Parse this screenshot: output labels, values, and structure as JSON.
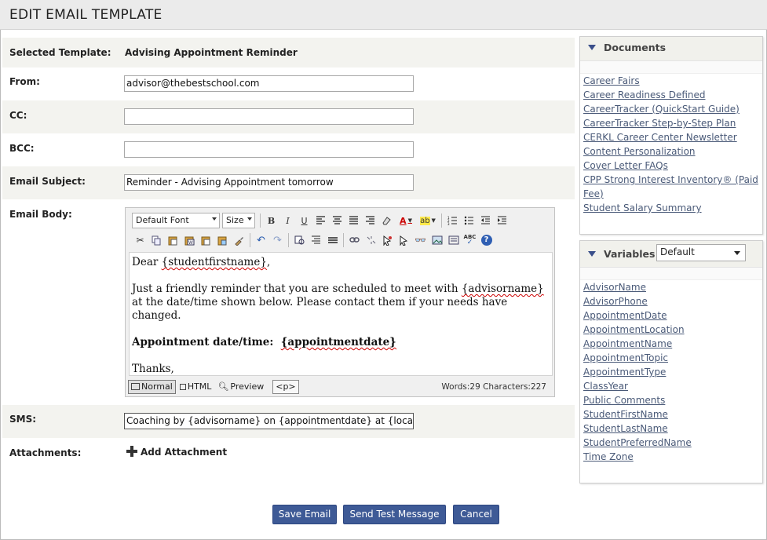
{
  "page_title": "EDIT EMAIL TEMPLATE",
  "form": {
    "selected_template_label": "Selected Template:",
    "selected_template_value": "Advising Appointment Reminder",
    "from_label": "From:",
    "from_value": "advisor@thebestschool.com",
    "cc_label": "CC:",
    "cc_value": "",
    "bcc_label": "BCC:",
    "bcc_value": "",
    "subject_label": "Email Subject:",
    "subject_value": "Reminder - Advising Appointment tomorrow",
    "body_label": "Email Body:",
    "sms_label": "SMS:",
    "sms_value": "Coaching by {advisorname} on {appointmentdate} at {location} t",
    "attachments_label": "Attachments:",
    "add_attachment": "Add Attachment"
  },
  "editor": {
    "font_select": "Default Font",
    "size_select": "Size",
    "toolbar_bold": "B",
    "toolbar_italic": "I",
    "toolbar_underline": "U",
    "toolbar_font_color": "A",
    "toolbar_highlight": "ab",
    "toolbar_spell": "ABC",
    "toolbar_help": "?",
    "content": {
      "greeting_prefix": "Dear ",
      "greeting_var": "{studentfirstname}",
      "greeting_suffix": ",",
      "para1_a": "Just a friendly reminder that you are scheduled to meet with ",
      "para1_var": "{advisorname}",
      "para1_b": " at the date/time shown below.  Please contact them if your needs have changed.",
      "appt_label": "Appointment date/time:  ",
      "appt_var": "{appointmentdate}",
      "closing": "Thanks,"
    },
    "modes": {
      "normal": "Normal",
      "html": "HTML",
      "preview": "Preview",
      "tag": "<p>"
    },
    "word_count": "Words:29 Characters:227"
  },
  "buttons": {
    "save": "Save Email",
    "test": "Send Test Message",
    "cancel": "Cancel"
  },
  "colors": {
    "button_bg": "#3e5a96",
    "link": "#4a5a78",
    "row_shade": "#f3f3ef"
  },
  "documents": {
    "title": "Documents",
    "items": [
      "Career Fairs",
      "Career Readiness Defined",
      "CareerTracker (QuickStart Guide)",
      "CareerTracker Step-by-Step Plan",
      "CERKL Career Center Newsletter",
      "Content Personalization",
      "Cover Letter FAQs",
      "CPP Strong Interest Inventory® (Paid Fee)",
      "Student Salary Summary"
    ]
  },
  "variables": {
    "title": "Variables",
    "select_value": "Default",
    "items": [
      "AdvisorName",
      "AdvisorPhone",
      "AppointmentDate",
      "AppointmentLocation",
      "AppointmentName",
      "AppointmentTopic",
      "AppointmentType",
      "ClassYear",
      "Public Comments",
      "StudentFirstName",
      "StudentLastName",
      "StudentPreferredName",
      "Time Zone"
    ]
  }
}
